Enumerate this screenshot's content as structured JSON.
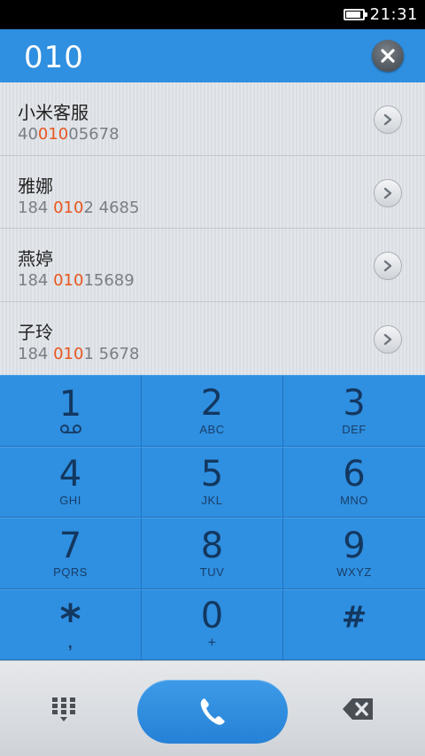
{
  "status": {
    "time": "21:31",
    "battery_level": 0.9
  },
  "header": {
    "dialed_number": "010"
  },
  "results": [
    {
      "name": "小米客服",
      "number_pre": "40",
      "number_match": "010",
      "number_post": "05678"
    },
    {
      "name": "雅娜",
      "number_pre": "184 ",
      "number_match": "010",
      "number_post": "2 4685"
    },
    {
      "name": "燕婷",
      "number_pre": "184 ",
      "number_match": "010",
      "number_post": "15689"
    },
    {
      "name": "子玲",
      "number_pre": "184 ",
      "number_match": "010",
      "number_post": "1 5678"
    }
  ],
  "keypad": [
    {
      "digit": "1",
      "letters": ""
    },
    {
      "digit": "2",
      "letters": "ABC"
    },
    {
      "digit": "3",
      "letters": "DEF"
    },
    {
      "digit": "4",
      "letters": "GHI"
    },
    {
      "digit": "5",
      "letters": "JKL"
    },
    {
      "digit": "6",
      "letters": "MNO"
    },
    {
      "digit": "7",
      "letters": "PQRS"
    },
    {
      "digit": "8",
      "letters": "TUV"
    },
    {
      "digit": "9",
      "letters": "WXYZ"
    },
    {
      "digit": "*",
      "letters": ","
    },
    {
      "digit": "0",
      "letters": "+"
    },
    {
      "digit": "#",
      "letters": ""
    }
  ],
  "colors": {
    "accent": "#2f8fe0",
    "match_highlight": "#e8561f",
    "key_text": "#13375f"
  },
  "icons": {
    "clear": "close-icon",
    "row_action": "chevron-right-icon",
    "voicemail": "voicemail-icon",
    "dialpad_toggle": "dialpad-icon",
    "call": "phone-icon",
    "delete": "backspace-icon"
  }
}
